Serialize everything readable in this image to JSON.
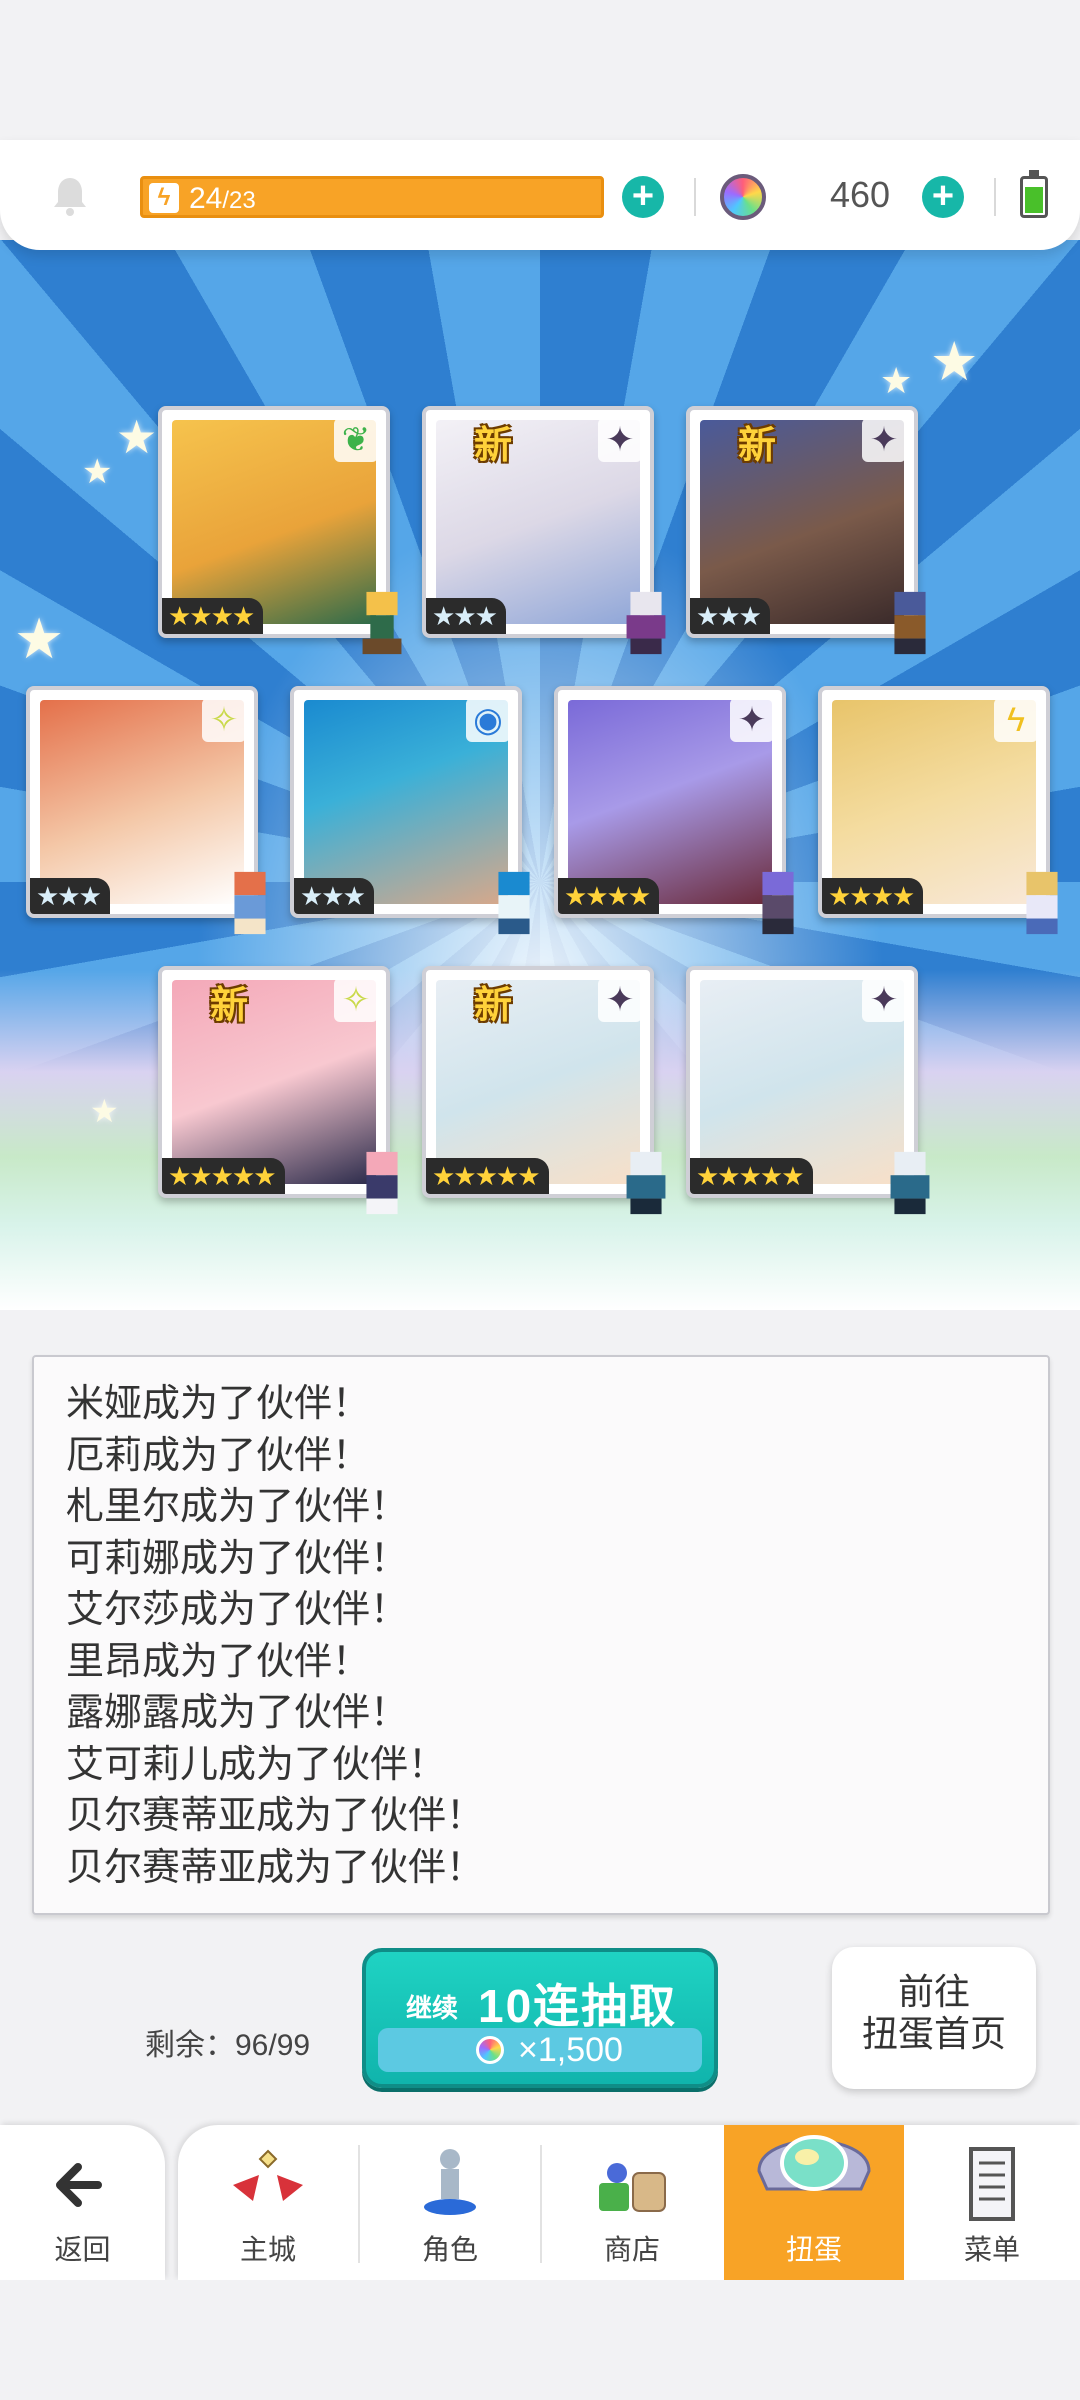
{
  "status": {
    "energy_current": "24",
    "energy_max": "/23",
    "gems": "460"
  },
  "cards": [
    {
      "badge": "",
      "element": "leaf-icon",
      "stars": "★★★★",
      "star_color": "gold"
    },
    {
      "badge": "新",
      "element": "dark-icon",
      "stars": "★★★",
      "star_color": "silver"
    },
    {
      "badge": "新",
      "element": "dark-icon",
      "stars": "★★★",
      "star_color": "silver"
    },
    {
      "badge": "",
      "element": "light-icon",
      "stars": "★★★",
      "star_color": "silver"
    },
    {
      "badge": "",
      "element": "water-icon",
      "stars": "★★★",
      "star_color": "silver"
    },
    {
      "badge": "",
      "element": "dark-icon",
      "stars": "★★★★",
      "star_color": "gold"
    },
    {
      "badge": "",
      "element": "thunder-icon",
      "stars": "★★★★",
      "star_color": "gold"
    },
    {
      "badge": "新",
      "element": "light-icon",
      "stars": "★★★★★",
      "star_color": "gold"
    },
    {
      "badge": "新",
      "element": "dark-icon",
      "stars": "★★★★★",
      "star_color": "gold"
    },
    {
      "badge": "",
      "element": "dark-icon",
      "stars": "★★★★★",
      "star_color": "gold"
    }
  ],
  "log": [
    "米娅成为了伙伴！",
    "厄莉成为了伙伴！",
    "札里尔成为了伙伴！",
    "可莉娜成为了伙伴！",
    "艾尔莎成为了伙伴！",
    "里昂成为了伙伴！",
    "露娜露成为了伙伴！",
    "艾可莉儿成为了伙伴！",
    "贝尔赛蒂亚成为了伙伴！",
    "贝尔赛蒂亚成为了伙伴！"
  ],
  "action": {
    "remaining": "剩余：96/99",
    "continue_label": "继续",
    "pull_label": "10连抽取",
    "pull_cost": "×1,500",
    "goto_line1": "前往",
    "goto_line2": "扭蛋首页"
  },
  "nav": {
    "back": "返回",
    "items": [
      "主城",
      "角色",
      "商店",
      "扭蛋",
      "菜单"
    ],
    "active_index": 3
  },
  "colors": {
    "accent_orange": "#f8a326",
    "accent_teal": "#17b7a8"
  }
}
